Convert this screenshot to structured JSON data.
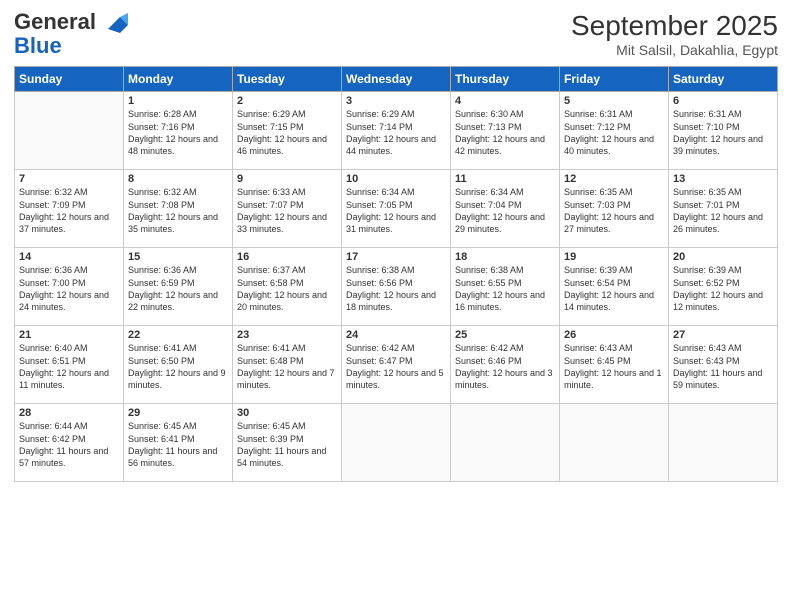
{
  "header": {
    "logo_general": "General",
    "logo_blue": "Blue",
    "month_title": "September 2025",
    "location": "Mit Salsil, Dakahlia, Egypt"
  },
  "days_of_week": [
    "Sunday",
    "Monday",
    "Tuesday",
    "Wednesday",
    "Thursday",
    "Friday",
    "Saturday"
  ],
  "weeks": [
    [
      {
        "day": "",
        "sunrise": "",
        "sunset": "",
        "daylight": ""
      },
      {
        "day": "1",
        "sunrise": "Sunrise: 6:28 AM",
        "sunset": "Sunset: 7:16 PM",
        "daylight": "Daylight: 12 hours and 48 minutes."
      },
      {
        "day": "2",
        "sunrise": "Sunrise: 6:29 AM",
        "sunset": "Sunset: 7:15 PM",
        "daylight": "Daylight: 12 hours and 46 minutes."
      },
      {
        "day": "3",
        "sunrise": "Sunrise: 6:29 AM",
        "sunset": "Sunset: 7:14 PM",
        "daylight": "Daylight: 12 hours and 44 minutes."
      },
      {
        "day": "4",
        "sunrise": "Sunrise: 6:30 AM",
        "sunset": "Sunset: 7:13 PM",
        "daylight": "Daylight: 12 hours and 42 minutes."
      },
      {
        "day": "5",
        "sunrise": "Sunrise: 6:31 AM",
        "sunset": "Sunset: 7:12 PM",
        "daylight": "Daylight: 12 hours and 40 minutes."
      },
      {
        "day": "6",
        "sunrise": "Sunrise: 6:31 AM",
        "sunset": "Sunset: 7:10 PM",
        "daylight": "Daylight: 12 hours and 39 minutes."
      }
    ],
    [
      {
        "day": "7",
        "sunrise": "Sunrise: 6:32 AM",
        "sunset": "Sunset: 7:09 PM",
        "daylight": "Daylight: 12 hours and 37 minutes."
      },
      {
        "day": "8",
        "sunrise": "Sunrise: 6:32 AM",
        "sunset": "Sunset: 7:08 PM",
        "daylight": "Daylight: 12 hours and 35 minutes."
      },
      {
        "day": "9",
        "sunrise": "Sunrise: 6:33 AM",
        "sunset": "Sunset: 7:07 PM",
        "daylight": "Daylight: 12 hours and 33 minutes."
      },
      {
        "day": "10",
        "sunrise": "Sunrise: 6:34 AM",
        "sunset": "Sunset: 7:05 PM",
        "daylight": "Daylight: 12 hours and 31 minutes."
      },
      {
        "day": "11",
        "sunrise": "Sunrise: 6:34 AM",
        "sunset": "Sunset: 7:04 PM",
        "daylight": "Daylight: 12 hours and 29 minutes."
      },
      {
        "day": "12",
        "sunrise": "Sunrise: 6:35 AM",
        "sunset": "Sunset: 7:03 PM",
        "daylight": "Daylight: 12 hours and 27 minutes."
      },
      {
        "day": "13",
        "sunrise": "Sunrise: 6:35 AM",
        "sunset": "Sunset: 7:01 PM",
        "daylight": "Daylight: 12 hours and 26 minutes."
      }
    ],
    [
      {
        "day": "14",
        "sunrise": "Sunrise: 6:36 AM",
        "sunset": "Sunset: 7:00 PM",
        "daylight": "Daylight: 12 hours and 24 minutes."
      },
      {
        "day": "15",
        "sunrise": "Sunrise: 6:36 AM",
        "sunset": "Sunset: 6:59 PM",
        "daylight": "Daylight: 12 hours and 22 minutes."
      },
      {
        "day": "16",
        "sunrise": "Sunrise: 6:37 AM",
        "sunset": "Sunset: 6:58 PM",
        "daylight": "Daylight: 12 hours and 20 minutes."
      },
      {
        "day": "17",
        "sunrise": "Sunrise: 6:38 AM",
        "sunset": "Sunset: 6:56 PM",
        "daylight": "Daylight: 12 hours and 18 minutes."
      },
      {
        "day": "18",
        "sunrise": "Sunrise: 6:38 AM",
        "sunset": "Sunset: 6:55 PM",
        "daylight": "Daylight: 12 hours and 16 minutes."
      },
      {
        "day": "19",
        "sunrise": "Sunrise: 6:39 AM",
        "sunset": "Sunset: 6:54 PM",
        "daylight": "Daylight: 12 hours and 14 minutes."
      },
      {
        "day": "20",
        "sunrise": "Sunrise: 6:39 AM",
        "sunset": "Sunset: 6:52 PM",
        "daylight": "Daylight: 12 hours and 12 minutes."
      }
    ],
    [
      {
        "day": "21",
        "sunrise": "Sunrise: 6:40 AM",
        "sunset": "Sunset: 6:51 PM",
        "daylight": "Daylight: 12 hours and 11 minutes."
      },
      {
        "day": "22",
        "sunrise": "Sunrise: 6:41 AM",
        "sunset": "Sunset: 6:50 PM",
        "daylight": "Daylight: 12 hours and 9 minutes."
      },
      {
        "day": "23",
        "sunrise": "Sunrise: 6:41 AM",
        "sunset": "Sunset: 6:48 PM",
        "daylight": "Daylight: 12 hours and 7 minutes."
      },
      {
        "day": "24",
        "sunrise": "Sunrise: 6:42 AM",
        "sunset": "Sunset: 6:47 PM",
        "daylight": "Daylight: 12 hours and 5 minutes."
      },
      {
        "day": "25",
        "sunrise": "Sunrise: 6:42 AM",
        "sunset": "Sunset: 6:46 PM",
        "daylight": "Daylight: 12 hours and 3 minutes."
      },
      {
        "day": "26",
        "sunrise": "Sunrise: 6:43 AM",
        "sunset": "Sunset: 6:45 PM",
        "daylight": "Daylight: 12 hours and 1 minute."
      },
      {
        "day": "27",
        "sunrise": "Sunrise: 6:43 AM",
        "sunset": "Sunset: 6:43 PM",
        "daylight": "Daylight: 11 hours and 59 minutes."
      }
    ],
    [
      {
        "day": "28",
        "sunrise": "Sunrise: 6:44 AM",
        "sunset": "Sunset: 6:42 PM",
        "daylight": "Daylight: 11 hours and 57 minutes."
      },
      {
        "day": "29",
        "sunrise": "Sunrise: 6:45 AM",
        "sunset": "Sunset: 6:41 PM",
        "daylight": "Daylight: 11 hours and 56 minutes."
      },
      {
        "day": "30",
        "sunrise": "Sunrise: 6:45 AM",
        "sunset": "Sunset: 6:39 PM",
        "daylight": "Daylight: 11 hours and 54 minutes."
      },
      {
        "day": "",
        "sunrise": "",
        "sunset": "",
        "daylight": ""
      },
      {
        "day": "",
        "sunrise": "",
        "sunset": "",
        "daylight": ""
      },
      {
        "day": "",
        "sunrise": "",
        "sunset": "",
        "daylight": ""
      },
      {
        "day": "",
        "sunrise": "",
        "sunset": "",
        "daylight": ""
      }
    ]
  ]
}
